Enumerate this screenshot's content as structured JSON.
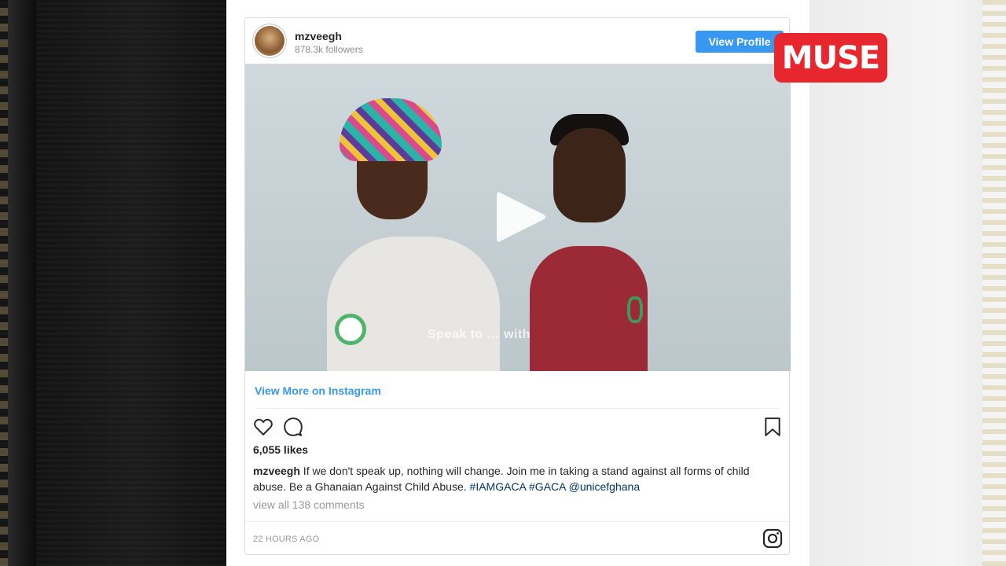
{
  "post": {
    "username": "mzveegh",
    "followers": "878.3k followers",
    "view_profile_label": "View Profile",
    "video_subtitle": "Speak to … with",
    "view_more_label": "View More on Instagram",
    "likes": "6,055 likes",
    "caption_user": "mzveegh",
    "caption_text": " If we don't speak up, nothing will change. Join me in taking a stand against all forms of child abuse. Be a Ghanaian Against Child Abuse. ",
    "hashtags": [
      "#IAMGACA",
      "#GACA",
      "@unicefghana"
    ],
    "view_comments": "view all 138 comments",
    "timestamp": "22 HOURS AGO"
  },
  "watermark": {
    "text": "MUSE",
    "color": "#e8262e"
  },
  "icons": {
    "like": "heart-icon",
    "comment": "comment-icon",
    "save": "bookmark-icon",
    "instagram": "instagram-icon",
    "play": "play-icon"
  },
  "colors": {
    "accent": "#3897f0",
    "hashtag": "#003569"
  }
}
